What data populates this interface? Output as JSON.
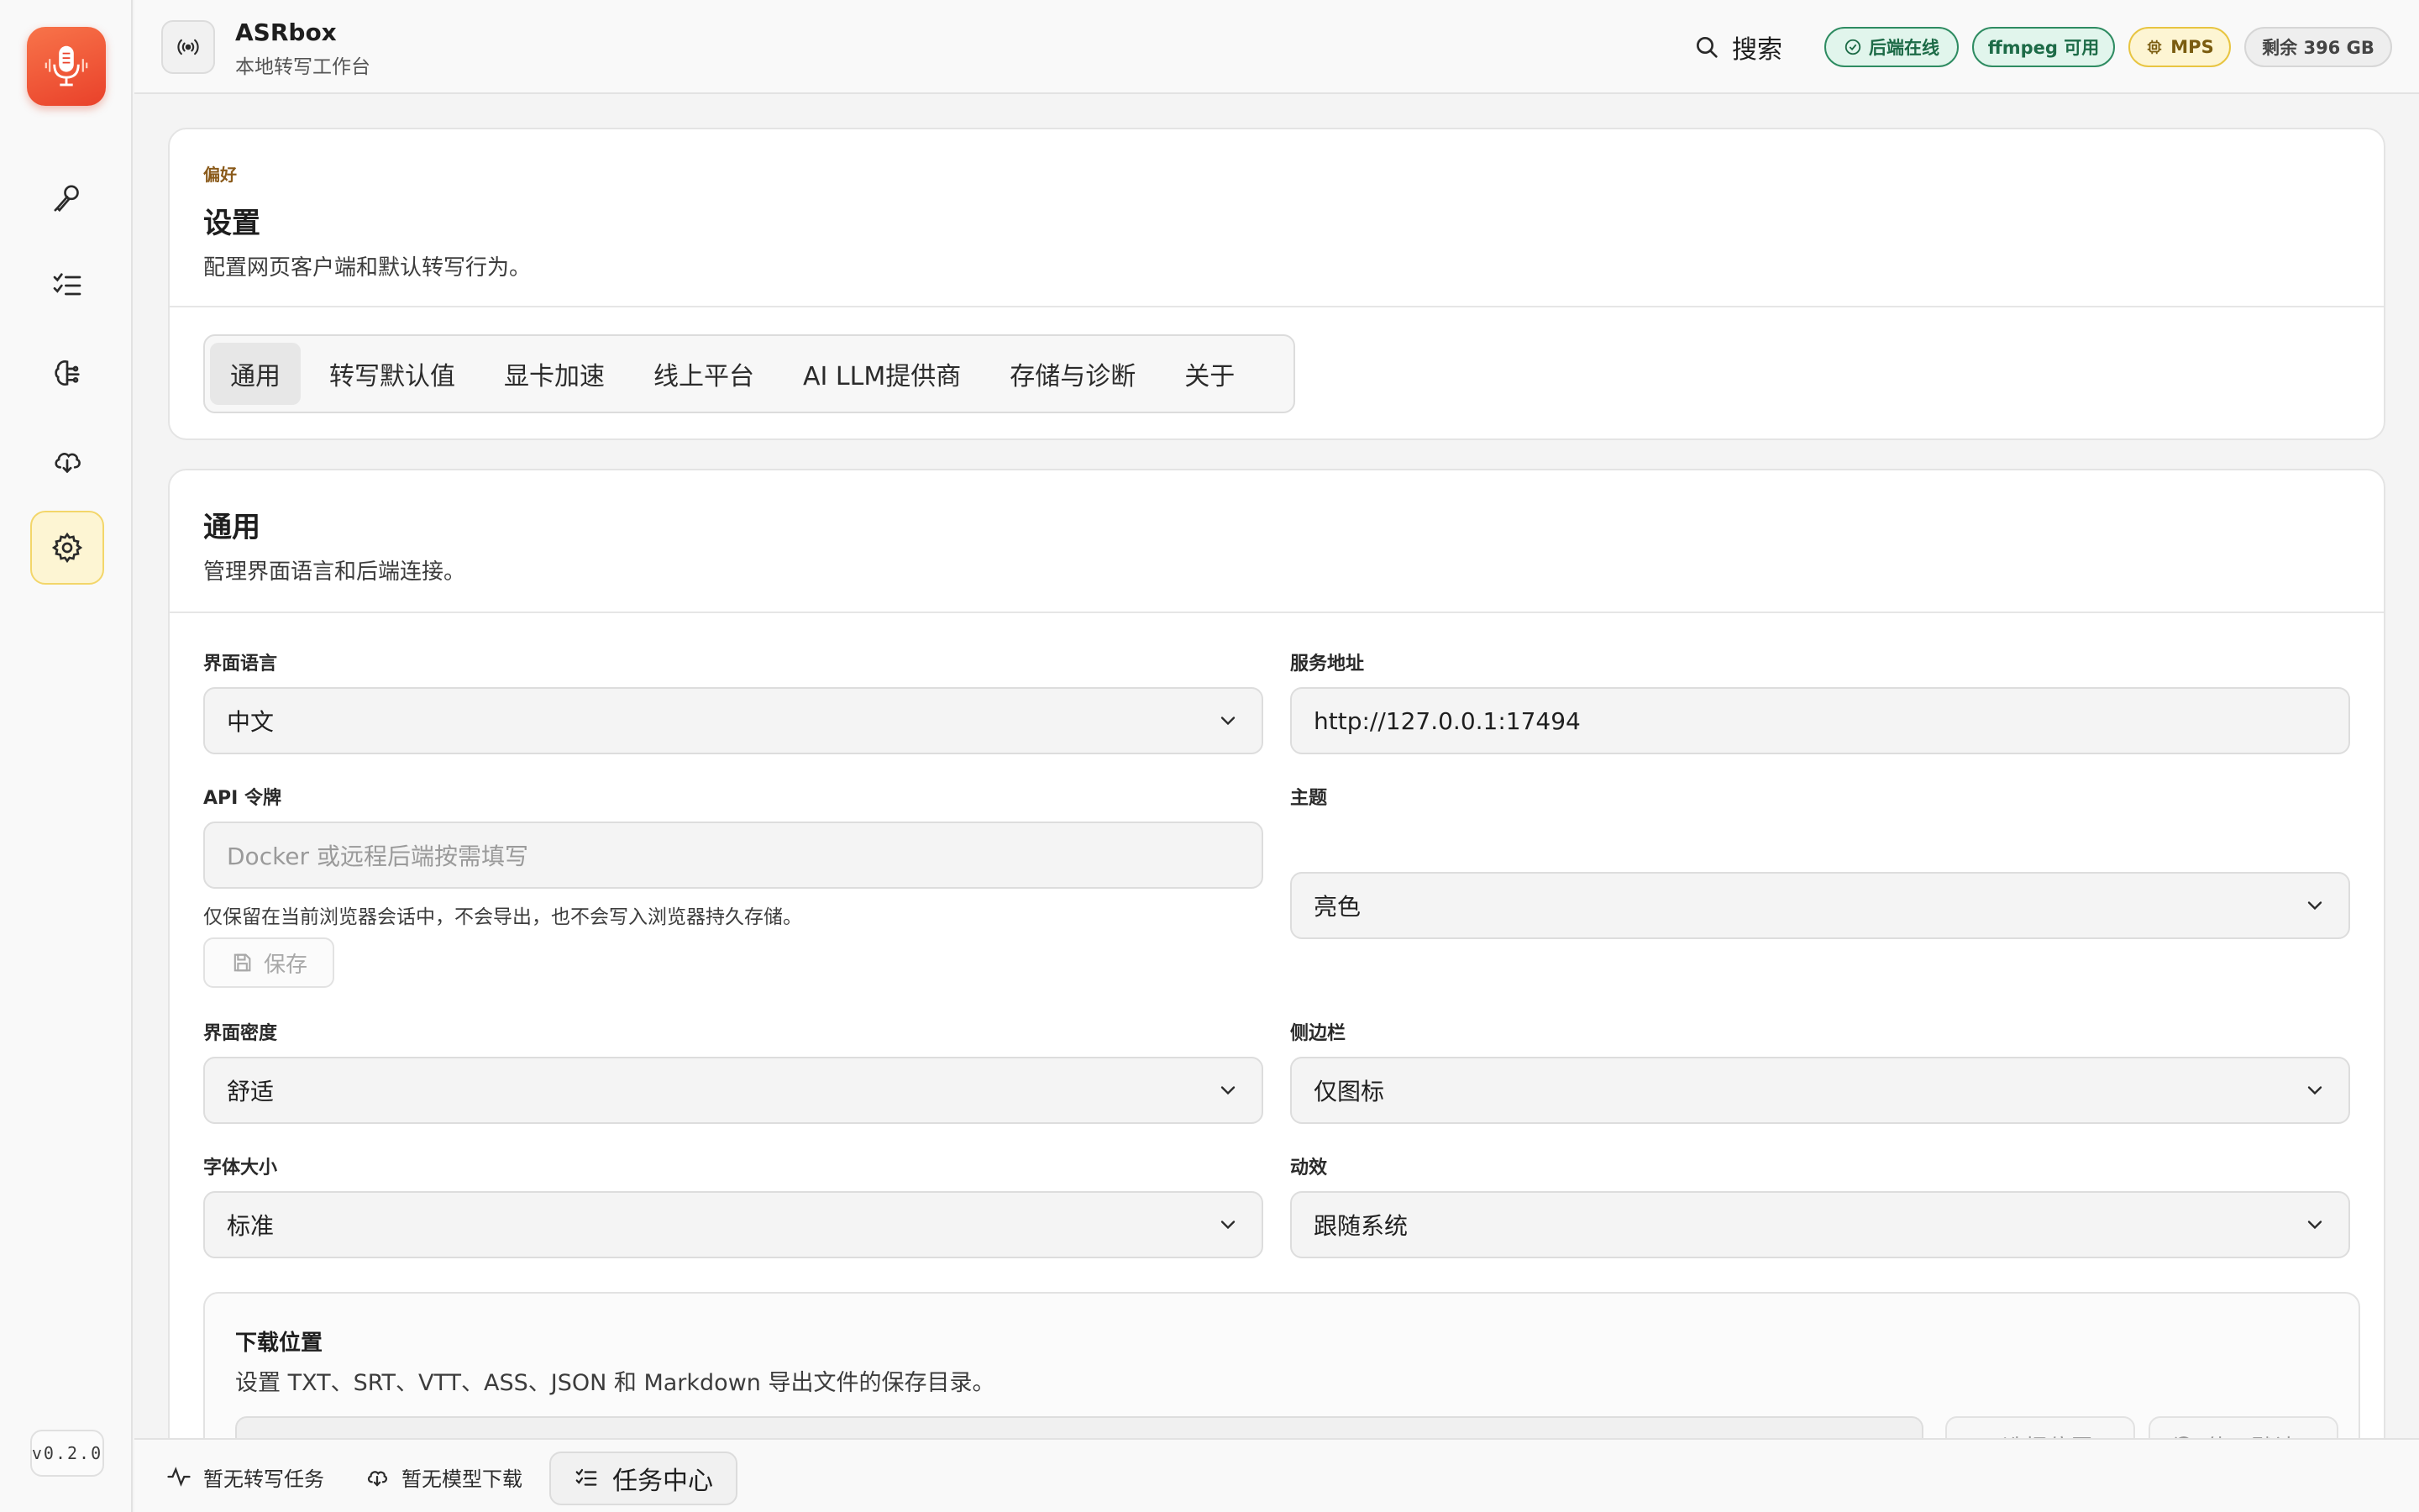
{
  "app": {
    "title": "ASRbox",
    "subtitle": "本地转写工作台",
    "version": "v0.2.0"
  },
  "header": {
    "search_label": "搜索",
    "badges": {
      "backend": "后端在线",
      "ffmpeg": "ffmpeg 可用",
      "mps": "MPS",
      "disk": "剩余 396 GB"
    }
  },
  "sidebar": {
    "items": [
      {
        "name": "transcribe",
        "icon": "microphone-icon"
      },
      {
        "name": "tasks",
        "icon": "checklist-icon"
      },
      {
        "name": "models",
        "icon": "brain-icon"
      },
      {
        "name": "downloads",
        "icon": "cloud-download-icon"
      },
      {
        "name": "settings",
        "icon": "gear-icon",
        "active": true
      }
    ]
  },
  "settings_header": {
    "eyebrow": "偏好",
    "title": "设置",
    "description": "配置网页客户端和默认转写行为。"
  },
  "tabs": [
    {
      "label": "通用",
      "active": true
    },
    {
      "label": "转写默认值"
    },
    {
      "label": "显卡加速"
    },
    {
      "label": "线上平台"
    },
    {
      "label": "AI LLM提供商"
    },
    {
      "label": "存储与诊断"
    },
    {
      "label": "关于"
    }
  ],
  "general": {
    "title": "通用",
    "description": "管理界面语言和后端连接。",
    "language": {
      "label": "界面语言",
      "value": "中文"
    },
    "service_url": {
      "label": "服务地址",
      "value": "http://127.0.0.1:17494"
    },
    "api_token": {
      "label": "API 令牌",
      "placeholder": "Docker 或远程后端按需填写",
      "hint": "仅保留在当前浏览器会话中，不会导出，也不会写入浏览器持久存储。",
      "save_label": "保存"
    },
    "theme": {
      "label": "主题",
      "value": "亮色"
    },
    "density": {
      "label": "界面密度",
      "value": "舒适"
    },
    "sidebar_mode": {
      "label": "侧边栏",
      "value": "仅图标"
    },
    "font_size": {
      "label": "字体大小",
      "value": "标准"
    },
    "motion": {
      "label": "动效",
      "value": "跟随系统"
    },
    "download_location": {
      "title": "下载位置",
      "description": "设置 TXT、SRT、VTT、ASS、JSON 和 Markdown 导出文件的保存目录。",
      "choose_label": "选择位置",
      "default_label": "使用默认"
    }
  },
  "bottombar": {
    "no_transcribe": "暂无转写任务",
    "no_model": "暂无模型下载",
    "task_center": "任务中心"
  },
  "colors": {
    "accent_orange": "#e9412a",
    "active_nav_bg": "#fdf5d3",
    "status_green": "#2f8c62",
    "status_yellow": "#e8c542"
  }
}
